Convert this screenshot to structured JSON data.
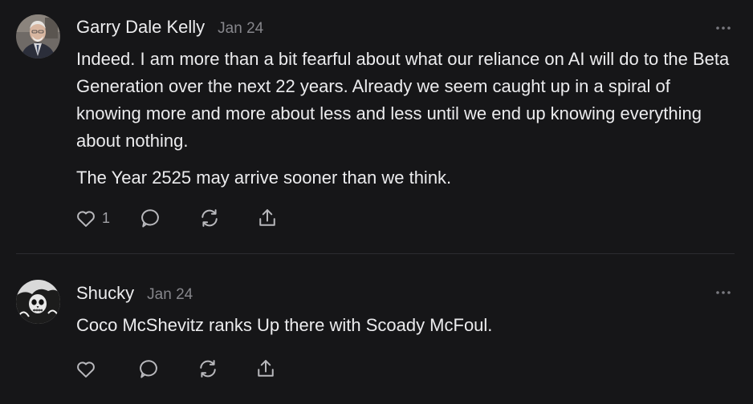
{
  "comments": [
    {
      "author": "Garry Dale Kelly",
      "date": "Jan 24",
      "paragraphs": [
        "Indeed. I am more than a bit fearful about what our reliance on AI will do to the Beta Generation over the next 22 years. Already we seem caught up in a spiral of knowing more and more about less and less until we end up knowing everything about nothing.",
        "The Year 2525 may arrive sooner than we think."
      ],
      "like_count": "1",
      "icons": [
        "heart-icon",
        "comment-icon",
        "restack-icon",
        "share-icon",
        "more-options-icon"
      ]
    },
    {
      "author": "Shucky",
      "date": "Jan 24",
      "paragraphs": [
        "Coco McShevitz ranks Up there with Scoady McFoul."
      ],
      "like_count": "",
      "icons": [
        "heart-icon",
        "comment-icon",
        "restack-icon",
        "share-icon",
        "more-options-icon"
      ]
    }
  ],
  "colors": {
    "background": "#161618",
    "text": "#ececee",
    "muted": "#86868b",
    "divider": "#2c2c30"
  }
}
